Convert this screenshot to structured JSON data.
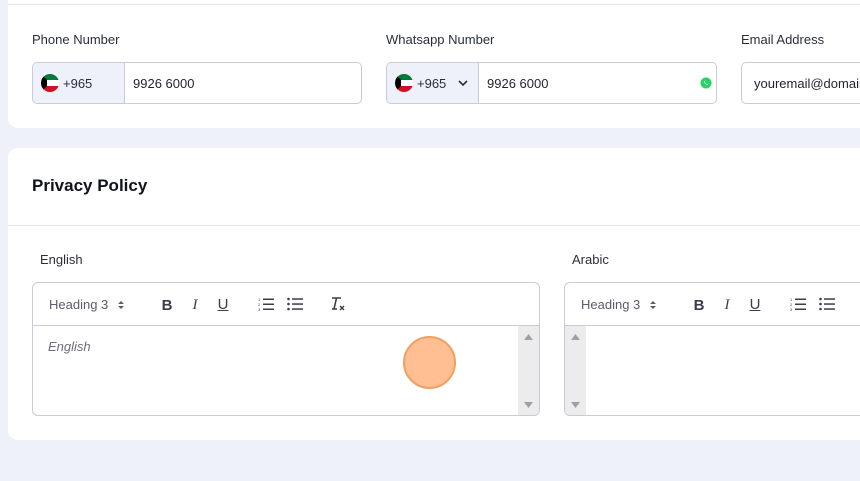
{
  "contact": {
    "phone": {
      "label": "Phone Number",
      "country_code": "+965",
      "value": "9926 6000"
    },
    "whatsapp": {
      "label": "Whatsapp Number",
      "country_code": "+965",
      "value": "9926 6000"
    },
    "email": {
      "label": "Email Address",
      "placeholder": "youremail@domain"
    }
  },
  "privacy": {
    "title": "Privacy Policy",
    "english": {
      "label": "English",
      "heading_select": "Heading 3",
      "placeholder": "English"
    },
    "arabic": {
      "label": "Arabic",
      "heading_select": "Heading 3",
      "placeholder": ""
    }
  },
  "toolbar_icons": [
    "bold-icon",
    "italic-icon",
    "underline-icon",
    "ordered-list-icon",
    "bullet-list-icon",
    "clear-format-icon"
  ],
  "colors": {
    "background": "#eef1f8",
    "card": "#ffffff",
    "border": "#c9ccd6",
    "whatsapp_green": "#25d366",
    "cursor": "#ffaa6e"
  }
}
